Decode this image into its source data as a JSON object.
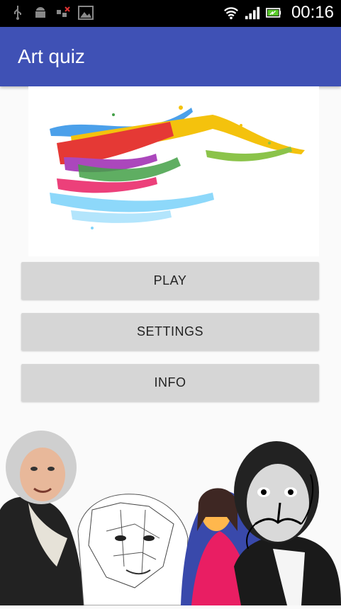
{
  "status_bar": {
    "time": "00:16",
    "icons": [
      "usb-icon",
      "android-icon",
      "signal-off-icon",
      "image-icon",
      "wifi-icon",
      "cell-signal-icon",
      "battery-icon"
    ]
  },
  "app_bar": {
    "title": "Art quiz"
  },
  "menu": {
    "play_label": "PLAY",
    "settings_label": "SETTINGS",
    "info_label": "INFO"
  },
  "colors": {
    "app_bar": "#3f51b5",
    "button_bg": "#d6d6d6",
    "background": "#fafafa"
  }
}
